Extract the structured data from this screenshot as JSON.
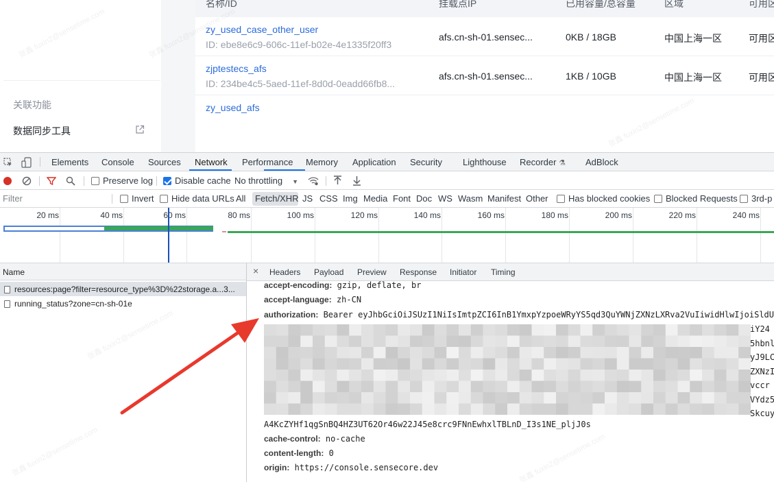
{
  "page": {
    "sidebar": {
      "section_title": "关联功能",
      "link_label": "数据同步工具",
      "link_icon": "external-link-icon"
    },
    "table": {
      "columns": [
        "名称/ID",
        "挂载点IP",
        "已用容量/总容量",
        "区域",
        "可用区"
      ],
      "rows": [
        {
          "name": "zy_used_case_other_user",
          "id": "ID: ebe8e6c9-606c-11ef-b02e-4e1335f20ff3",
          "mount_ip": "afs.cn-sh-01.sensec...",
          "capacity": "0KB / 18GB",
          "region": "中国上海一区",
          "zone": "可用区"
        },
        {
          "name": "zjptestecs_afs",
          "id": "ID: 234be4c5-5aed-11ef-8d0d-0eadd66fb8...",
          "mount_ip": "afs.cn-sh-01.sensec...",
          "capacity": "1KB / 10GB",
          "region": "中国上海一区",
          "zone": "可用区"
        },
        {
          "name": "zy_used_afs"
        }
      ]
    }
  },
  "devtools": {
    "tabs": [
      "Elements",
      "Console",
      "Sources",
      "Network",
      "Performance",
      "Memory",
      "Application",
      "Security",
      "Lighthouse",
      "Recorder",
      "AdBlock"
    ],
    "active_tab": "Network",
    "toolbar": {
      "preserve_log": "Preserve log",
      "preserve_log_checked": false,
      "disable_cache": "Disable cache",
      "disable_cache_checked": true,
      "throttling": "No throttling"
    },
    "filter": {
      "placeholder": "Filter",
      "invert": "Invert",
      "hide_data_urls": "Hide data URLs",
      "types": [
        "All",
        "Fetch/XHR",
        "JS",
        "CSS",
        "Img",
        "Media",
        "Font",
        "Doc",
        "WS",
        "Wasm",
        "Manifest",
        "Other"
      ],
      "active_type": "Fetch/XHR",
      "has_blocked_cookies": "Has blocked cookies",
      "blocked_requests": "Blocked Requests",
      "third_party": "3rd-p"
    },
    "timeline_ticks": [
      "20 ms",
      "40 ms",
      "60 ms",
      "80 ms",
      "100 ms",
      "120 ms",
      "140 ms",
      "160 ms",
      "180 ms",
      "200 ms",
      "220 ms",
      "240 ms"
    ],
    "requests_header": "Name",
    "requests": [
      "resources:page?filter=resource_type%3D%22storage.a...3...",
      "running_status?zone=cn-sh-01e"
    ],
    "detail_tabs": [
      "Headers",
      "Payload",
      "Preview",
      "Response",
      "Initiator",
      "Timing"
    ],
    "active_detail_tab": "Headers",
    "headers": {
      "accept_encoding_key": "accept-encoding:",
      "accept_encoding_val": "gzip, deflate, br",
      "accept_language_key": "accept-language:",
      "accept_language_val": "zh-CN",
      "authorization_key": "authorization:",
      "authorization_val": "Bearer eyJhbGciOiJSUzI1NiIsImtpZCI6InB1YmxpYzpoeWRyYS5qd3QuYWNjZXNzLXRva2VuIiwidHlwIjoiSldU",
      "authorization_tail": "A4KcZYHf1qgSnBQ4HZ3UT62Or46w22J45e8crc9FNnEwhxlTBLnD_I3s1NE_pljJ0s",
      "authorization_fragments": [
        "iY24",
        "5hbnl",
        "yJ9LC",
        "ZXNzI",
        "vccr",
        "VYdz5",
        "Skcuy"
      ],
      "cache_control_key": "cache-control:",
      "cache_control_val": "no-cache",
      "content_length_key": "content-length:",
      "content_length_val": "0",
      "origin_key": "origin:",
      "origin_val": "https://console.sensecore.dev"
    }
  },
  "annotation": {
    "arrow_color": "#e8392d"
  },
  "colors": {
    "link_blue": "#2a6bdb",
    "devtools_blue": "#1a73e8",
    "timeline_green": "#3aa757",
    "timeline_blue": "#4a7fd6"
  },
  "watermark": "张鑫 fuxin2@sensetime.com"
}
